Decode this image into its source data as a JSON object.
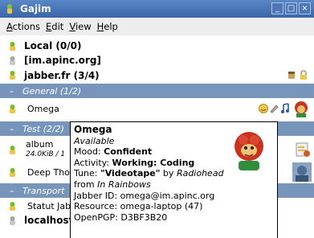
{
  "window": {
    "title": "Gajim"
  },
  "menu": [
    {
      "accel": "A",
      "rest": "ctions"
    },
    {
      "accel": "E",
      "rest": "dit"
    },
    {
      "accel": "V",
      "rest": "iew"
    },
    {
      "accel": "H",
      "rest": "elp"
    }
  ],
  "roster": {
    "account_local": "Local (0/0)",
    "account_apinc": "[im.apinc.org]",
    "account_jabber": "jabber.fr (3/4)",
    "group_general": "General (1/2)",
    "contact_omega": "Omega",
    "group_test": "Test (2/2)",
    "contact_album": "album",
    "contact_album_sub": "24.0KiB / 1",
    "contact_deep": "Deep Tho",
    "group_transport": "Transport",
    "contact_statut": "Statut Jab",
    "account_localhost": "localhost"
  },
  "tooltip": {
    "name": "Omega",
    "status": "Available",
    "mood_label": "Mood: ",
    "mood_value": "Confident",
    "activity_label": "Activity: ",
    "activity_value": "Working: Coding",
    "tune_label": "Tune: ",
    "tune_title": "\"Videotape\"",
    "tune_by": " by ",
    "tune_artist": "Radiohead",
    "tune_from": "from ",
    "tune_album": "In Rainbows",
    "jid": "Jabber ID: omega@im.apinc.org",
    "resource": "Resource: omega-laptop (47)",
    "openpgp": "OpenPGP: D3BF3B20"
  },
  "colors": {
    "titlebar": "#3a66a8",
    "group_row": "#7795ba",
    "status_online": "#6fbf2a"
  }
}
